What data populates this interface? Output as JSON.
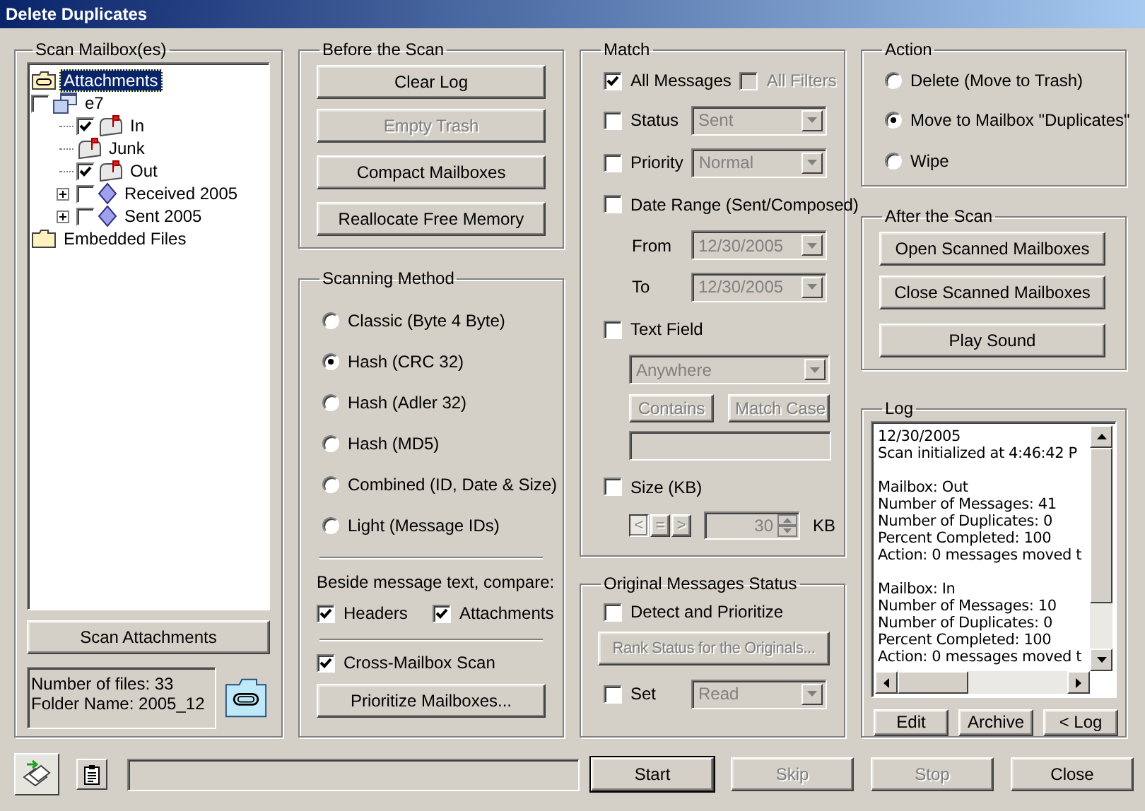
{
  "window": {
    "title": "Delete Duplicates"
  },
  "scan_mailboxes": {
    "title": "Scan Mailbox(es)",
    "tree": [
      {
        "label": "Attachments",
        "kind": "attachments",
        "selected": true
      },
      {
        "label": "e7",
        "kind": "account",
        "selected": false,
        "checked": false,
        "children": [
          {
            "label": "In",
            "kind": "mailbox",
            "selected": false,
            "checked": true
          },
          {
            "label": "Junk",
            "kind": "mailbox",
            "selected": false
          },
          {
            "label": "Out",
            "kind": "mailbox",
            "selected": false,
            "checked": true
          },
          {
            "label": "Received 2005",
            "kind": "folder_group",
            "selected": false,
            "checked": false,
            "expanded": false
          },
          {
            "label": "Sent 2005",
            "kind": "folder_group",
            "selected": false,
            "checked": false,
            "expanded": false
          }
        ]
      },
      {
        "label": "Embedded Files",
        "kind": "folder",
        "selected": false
      }
    ],
    "scan_button": "Scan Attachments",
    "info": [
      "Number of files: 33",
      "Folder Name: 2005_12"
    ]
  },
  "before_scan": {
    "title": "Before the Scan",
    "buttons": [
      {
        "label": "Clear Log",
        "disabled": false
      },
      {
        "label": "Empty Trash",
        "disabled": true
      },
      {
        "label": "Compact Mailboxes",
        "disabled": false
      },
      {
        "label": "Reallocate Free Memory",
        "disabled": false
      }
    ]
  },
  "scanning_method": {
    "title": "Scanning Method",
    "options": [
      {
        "label": "Classic (Byte 4 Byte)",
        "selected": false
      },
      {
        "label": "Hash (CRC 32)",
        "selected": true
      },
      {
        "label": "Hash (Adler 32)",
        "selected": false
      },
      {
        "label": "Hash (MD5)",
        "selected": false
      },
      {
        "label": "Combined (ID, Date & Size)",
        "selected": false
      },
      {
        "label": "Light (Message IDs)",
        "selected": false
      }
    ],
    "compare_label": "Beside message text, compare:",
    "compare": [
      {
        "label": "Headers",
        "checked": true
      },
      {
        "label": "Attachments",
        "checked": true
      }
    ],
    "cross_mailbox": {
      "label": "Cross-Mailbox Scan",
      "checked": true
    },
    "prioritize_button": "Prioritize Mailboxes..."
  },
  "match": {
    "title": "Match",
    "all_messages": {
      "label": "All Messages",
      "checked": true
    },
    "all_filters": {
      "label": "All Filters",
      "checked": false,
      "disabled": true
    },
    "status": {
      "label": "Status",
      "checked": false,
      "value": "Sent"
    },
    "priority": {
      "label": "Priority",
      "checked": false,
      "value": "Normal"
    },
    "date_range": {
      "label": "Date Range (Sent/Composed)",
      "checked": false,
      "from_label": "From",
      "from": "12/30/2005",
      "to_label": "To",
      "to": "12/30/2005"
    },
    "text_field": {
      "label": "Text Field",
      "checked": false,
      "scope": "Anywhere",
      "buttons": [
        "Contains",
        "Match Case"
      ]
    },
    "size": {
      "label": "Size (KB)",
      "checked": false,
      "operators": [
        {
          "label": "<",
          "selected": true
        },
        {
          "label": "=",
          "selected": false
        },
        {
          "label": ">",
          "selected": false
        }
      ],
      "value": "30",
      "unit": "KB"
    }
  },
  "original_status": {
    "title": "Original Messages Status",
    "detect": {
      "label": "Detect and Prioritize",
      "checked": false
    },
    "rank_button": "Rank Status for the Originals...",
    "set": {
      "label": "Set",
      "checked": false,
      "value": "Read"
    }
  },
  "action": {
    "title": "Action",
    "options": [
      {
        "label": "Delete (Move to Trash)",
        "selected": false
      },
      {
        "label": "Move to Mailbox \"Duplicates\"",
        "selected": true
      },
      {
        "label": "Wipe",
        "selected": false
      }
    ]
  },
  "after_scan": {
    "title": "After the Scan",
    "buttons": [
      "Open Scanned Mailboxes",
      "Close Scanned Mailboxes",
      "Play Sound"
    ]
  },
  "log": {
    "title": "Log",
    "blocks": [
      [
        "12/30/2005",
        "Scan initialized at 4:46:42 P"
      ],
      [
        "Mailbox: Out",
        "Number of Messages: 41",
        "Number of Duplicates: 0",
        "Percent Completed: 100",
        "Action: 0 messages moved t"
      ],
      [
        "Mailbox: In",
        "Number of Messages: 10",
        "Number of Duplicates: 0",
        "Percent Completed: 100",
        "Action: 0 messages moved t"
      ]
    ],
    "buttons": [
      "Edit",
      "Archive",
      "< Log"
    ]
  },
  "status_bar": {
    "progress": {
      "level": 0
    },
    "buttons": [
      {
        "label": "Start",
        "disabled": false,
        "default": true
      },
      {
        "label": "Skip",
        "disabled": true,
        "default": false
      },
      {
        "label": "Stop",
        "disabled": true,
        "default": false
      },
      {
        "label": "Close",
        "disabled": false,
        "default": false
      }
    ]
  }
}
